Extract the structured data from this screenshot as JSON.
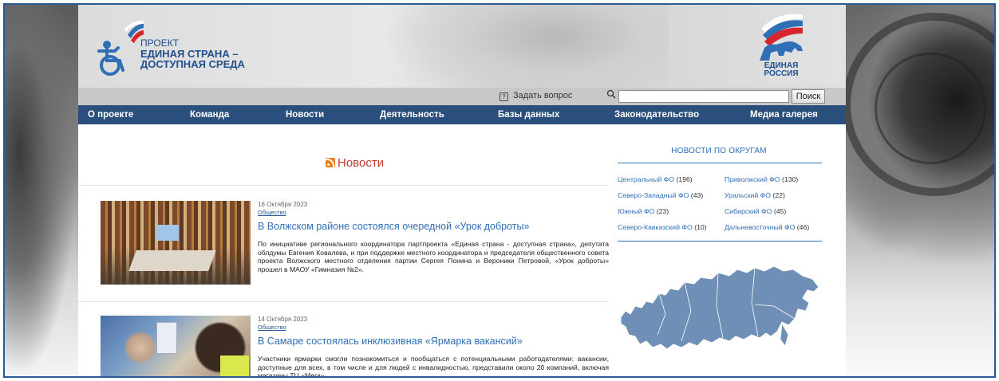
{
  "header": {
    "logo_left": {
      "line1": "ПРОЕКТ",
      "line2": "ЕДИНАЯ СТРАНА –",
      "line3": "ДОСТУПНАЯ СРЕДА"
    },
    "logo_right": {
      "line1": "ЕДИНАЯ",
      "line2": "РОССИЯ"
    }
  },
  "searchbar": {
    "ask_label": "Задать вопрос",
    "ask_icon_glyph": "?",
    "search_placeholder": "",
    "search_button": "Поиск"
  },
  "nav": {
    "items": [
      {
        "label": "О проекте"
      },
      {
        "label": "Команда"
      },
      {
        "label": "Новости"
      },
      {
        "label": "Деятельность"
      },
      {
        "label": "Базы данных"
      },
      {
        "label": "Законодательство"
      },
      {
        "label": "Медиа галерея"
      }
    ]
  },
  "main": {
    "section_title": "Новости",
    "articles": [
      {
        "date": "16 Октября 2023",
        "category": "Общество",
        "title": "В Волжском районе состоялся очередной «Урок доброты»",
        "body": "По инициативе регионального координатора партпроекта «Единая страна - доступная страна», депутата облдумы Евгения Ковалева, и при поддержке местного координатора и председателя общественного совета проекта Волжского местного отделения партии Сергея Понина и Вероники Петровой, «Урок доброты» прошел в МАОУ «Гимназия №2»."
      },
      {
        "date": "14 Октября 2023",
        "category": "Общество",
        "title": "В Самаре состоялась инклюзивная «Ярмарка вакансий»",
        "body": "Участники ярмарки смогли познакомиться и пообщаться с потенциальными работодателями: вакансии, доступные для всех, в том числе и для людей с инвалидностью, представили около 20 компаний, включая магазины ТЦ «Мега»."
      }
    ]
  },
  "sidebar": {
    "title": "НОВОСТИ ПО ОКРУГАМ",
    "districts": [
      {
        "name": "Центральный ФО",
        "count": "(196)"
      },
      {
        "name": "Приволжский ФО",
        "count": "(130)"
      },
      {
        "name": "Северо-Западный ФО",
        "count": "(43)"
      },
      {
        "name": "Уральский ФО",
        "count": "(22)"
      },
      {
        "name": "Южный ФО",
        "count": "(23)"
      },
      {
        "name": "Сибирский ФО",
        "count": "(45)"
      },
      {
        "name": "Северо-Кавказский ФО",
        "count": "(10)"
      },
      {
        "name": "Дальневосточный ФО",
        "count": "(46)"
      }
    ]
  },
  "colors": {
    "nav_bg": "#2b4f7d",
    "link_blue": "#2f6fb6",
    "news_title_red": "#c0392b",
    "map_fill": "#6f8fb7"
  },
  "icons": {
    "search": "magnifier-icon",
    "rss": "rss-icon",
    "question": "question-icon"
  }
}
